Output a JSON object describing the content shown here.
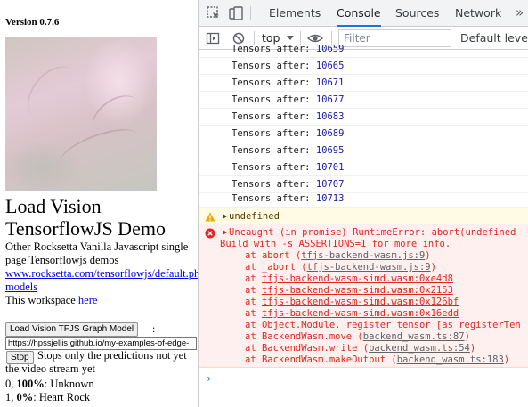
{
  "page": {
    "version": "Version 0.7.6",
    "title": "Load Vision TensorflowJS Demo",
    "desc_line1": "Other Rocksetta Vanilla Javascript single",
    "desc_line2": "page Tensorflowjs demos",
    "demos_link": "www.rocksetta.com/tensorflowjs/default.php",
    "models_link": "models",
    "workspace_text": "This workspace",
    "workspace_link": "here",
    "load_button": "Load Vision TFJS Graph Model",
    "colon": ":",
    "url_value": "https://hpssjellis.github.io/my-examples-of-edge-",
    "stop_button": "Stop",
    "stop_text": "Stops only the predictions not yet the video stream yet",
    "predictions": [
      {
        "index": "0,",
        "percent": "100%",
        "label": ": Unknown"
      },
      {
        "index": "1,",
        "percent": "0%",
        "label": ": Heart Rock"
      }
    ]
  },
  "devtools": {
    "tabs": [
      "Elements",
      "Console",
      "Sources",
      "Network"
    ],
    "active_tab": "Console",
    "more_tabs": "»",
    "context": "top",
    "filter_placeholder": "Filter",
    "levels": "Default levels",
    "log_prefix": "Tensors after: ",
    "logs": [
      "10659",
      "10665",
      "10671",
      "10677",
      "10683",
      "10689",
      "10695",
      "10701",
      "10707",
      "10713"
    ],
    "warning_text": "undefined",
    "error_title": "Uncaught (in promise) RuntimeError: abort(undefined",
    "error_line2": "Build with -s ASSERTIONS=1 for more info.",
    "stack": [
      {
        "prefix": "at abort (",
        "link": "tfjs-backend-wasm.js:9",
        "suffix": ")",
        "file": true
      },
      {
        "prefix": "at _abort (",
        "link": "tfjs-backend-wasm.js:9",
        "suffix": ")",
        "file": true
      },
      {
        "prefix": "at ",
        "link": "tfjs-backend-wasm-simd.wasm:0xe4d8",
        "suffix": "",
        "file": false
      },
      {
        "prefix": "at ",
        "link": "tfjs-backend-wasm-simd.wasm:0x2153",
        "suffix": "",
        "file": false
      },
      {
        "prefix": "at ",
        "link": "tfjs-backend-wasm-simd.wasm:0x126bf",
        "suffix": "",
        "file": false
      },
      {
        "prefix": "at ",
        "link": "tfjs-backend-wasm-simd.wasm:0x16edd",
        "suffix": "",
        "file": false
      },
      {
        "prefix": "at Object.Module._register_tensor [as registerTen",
        "link": "",
        "suffix": "",
        "file": false
      },
      {
        "prefix": "at BackendWasm.move (",
        "link": "backend_wasm.ts:87",
        "suffix": ")",
        "file": true
      },
      {
        "prefix": "at BackendWasm.write (",
        "link": "backend_wasm.ts:54",
        "suffix": ")",
        "file": true
      },
      {
        "prefix": "at BackendWasm.makeOutput (",
        "link": "backend_wasm.ts:183",
        "suffix": ")",
        "file": true
      }
    ],
    "prompt": "›"
  }
}
